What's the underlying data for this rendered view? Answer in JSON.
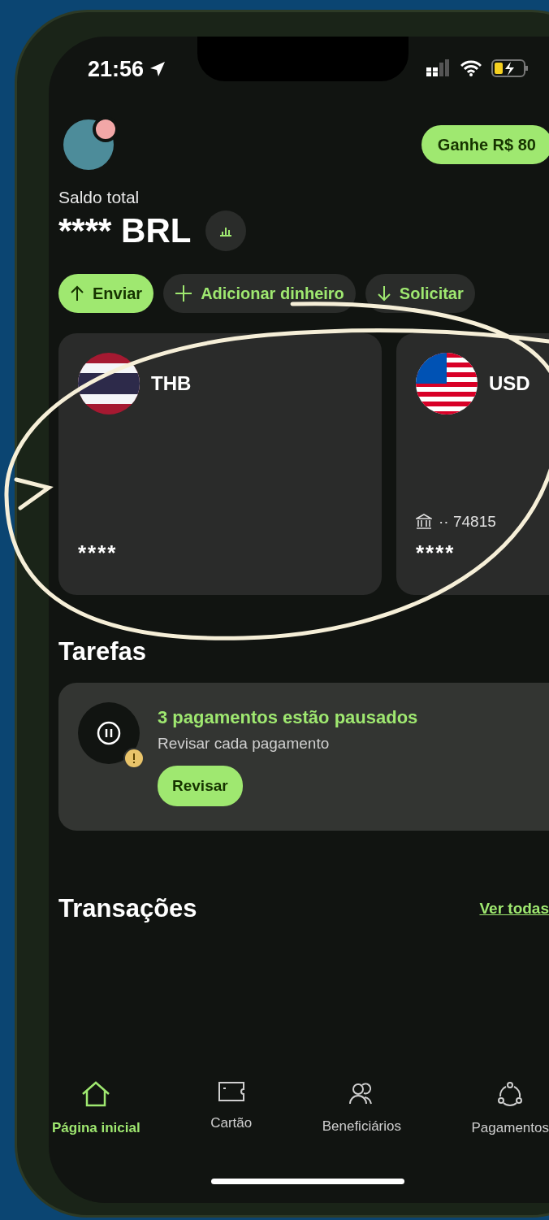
{
  "status_bar": {
    "time": "21:56"
  },
  "header": {
    "promo_button": "Ganhe R$ 80"
  },
  "balance": {
    "label": "Saldo total",
    "amount": "**** BRL"
  },
  "actions": [
    {
      "label": "Enviar",
      "kind": "primary"
    },
    {
      "label": "Adicionar dinheiro",
      "kind": "secondary"
    },
    {
      "label": "Solicitar",
      "kind": "secondary"
    }
  ],
  "accounts": [
    {
      "currency": "THB",
      "balance": "****"
    },
    {
      "currency": "USD",
      "account": "·· 74815",
      "balance": "****"
    }
  ],
  "tasks": {
    "title": "Tarefas",
    "items": [
      {
        "title": "3 pagamentos estão pausados",
        "subtitle": "Revisar cada pagamento",
        "button": "Revisar"
      }
    ]
  },
  "transactions": {
    "title": "Transações",
    "link": "Ver todas"
  },
  "nav": [
    {
      "label": "Página inicial",
      "selected": true
    },
    {
      "label": "Cartão",
      "selected": false
    },
    {
      "label": "Beneficiários",
      "selected": false
    },
    {
      "label": "Pagamentos",
      "selected": false
    }
  ]
}
